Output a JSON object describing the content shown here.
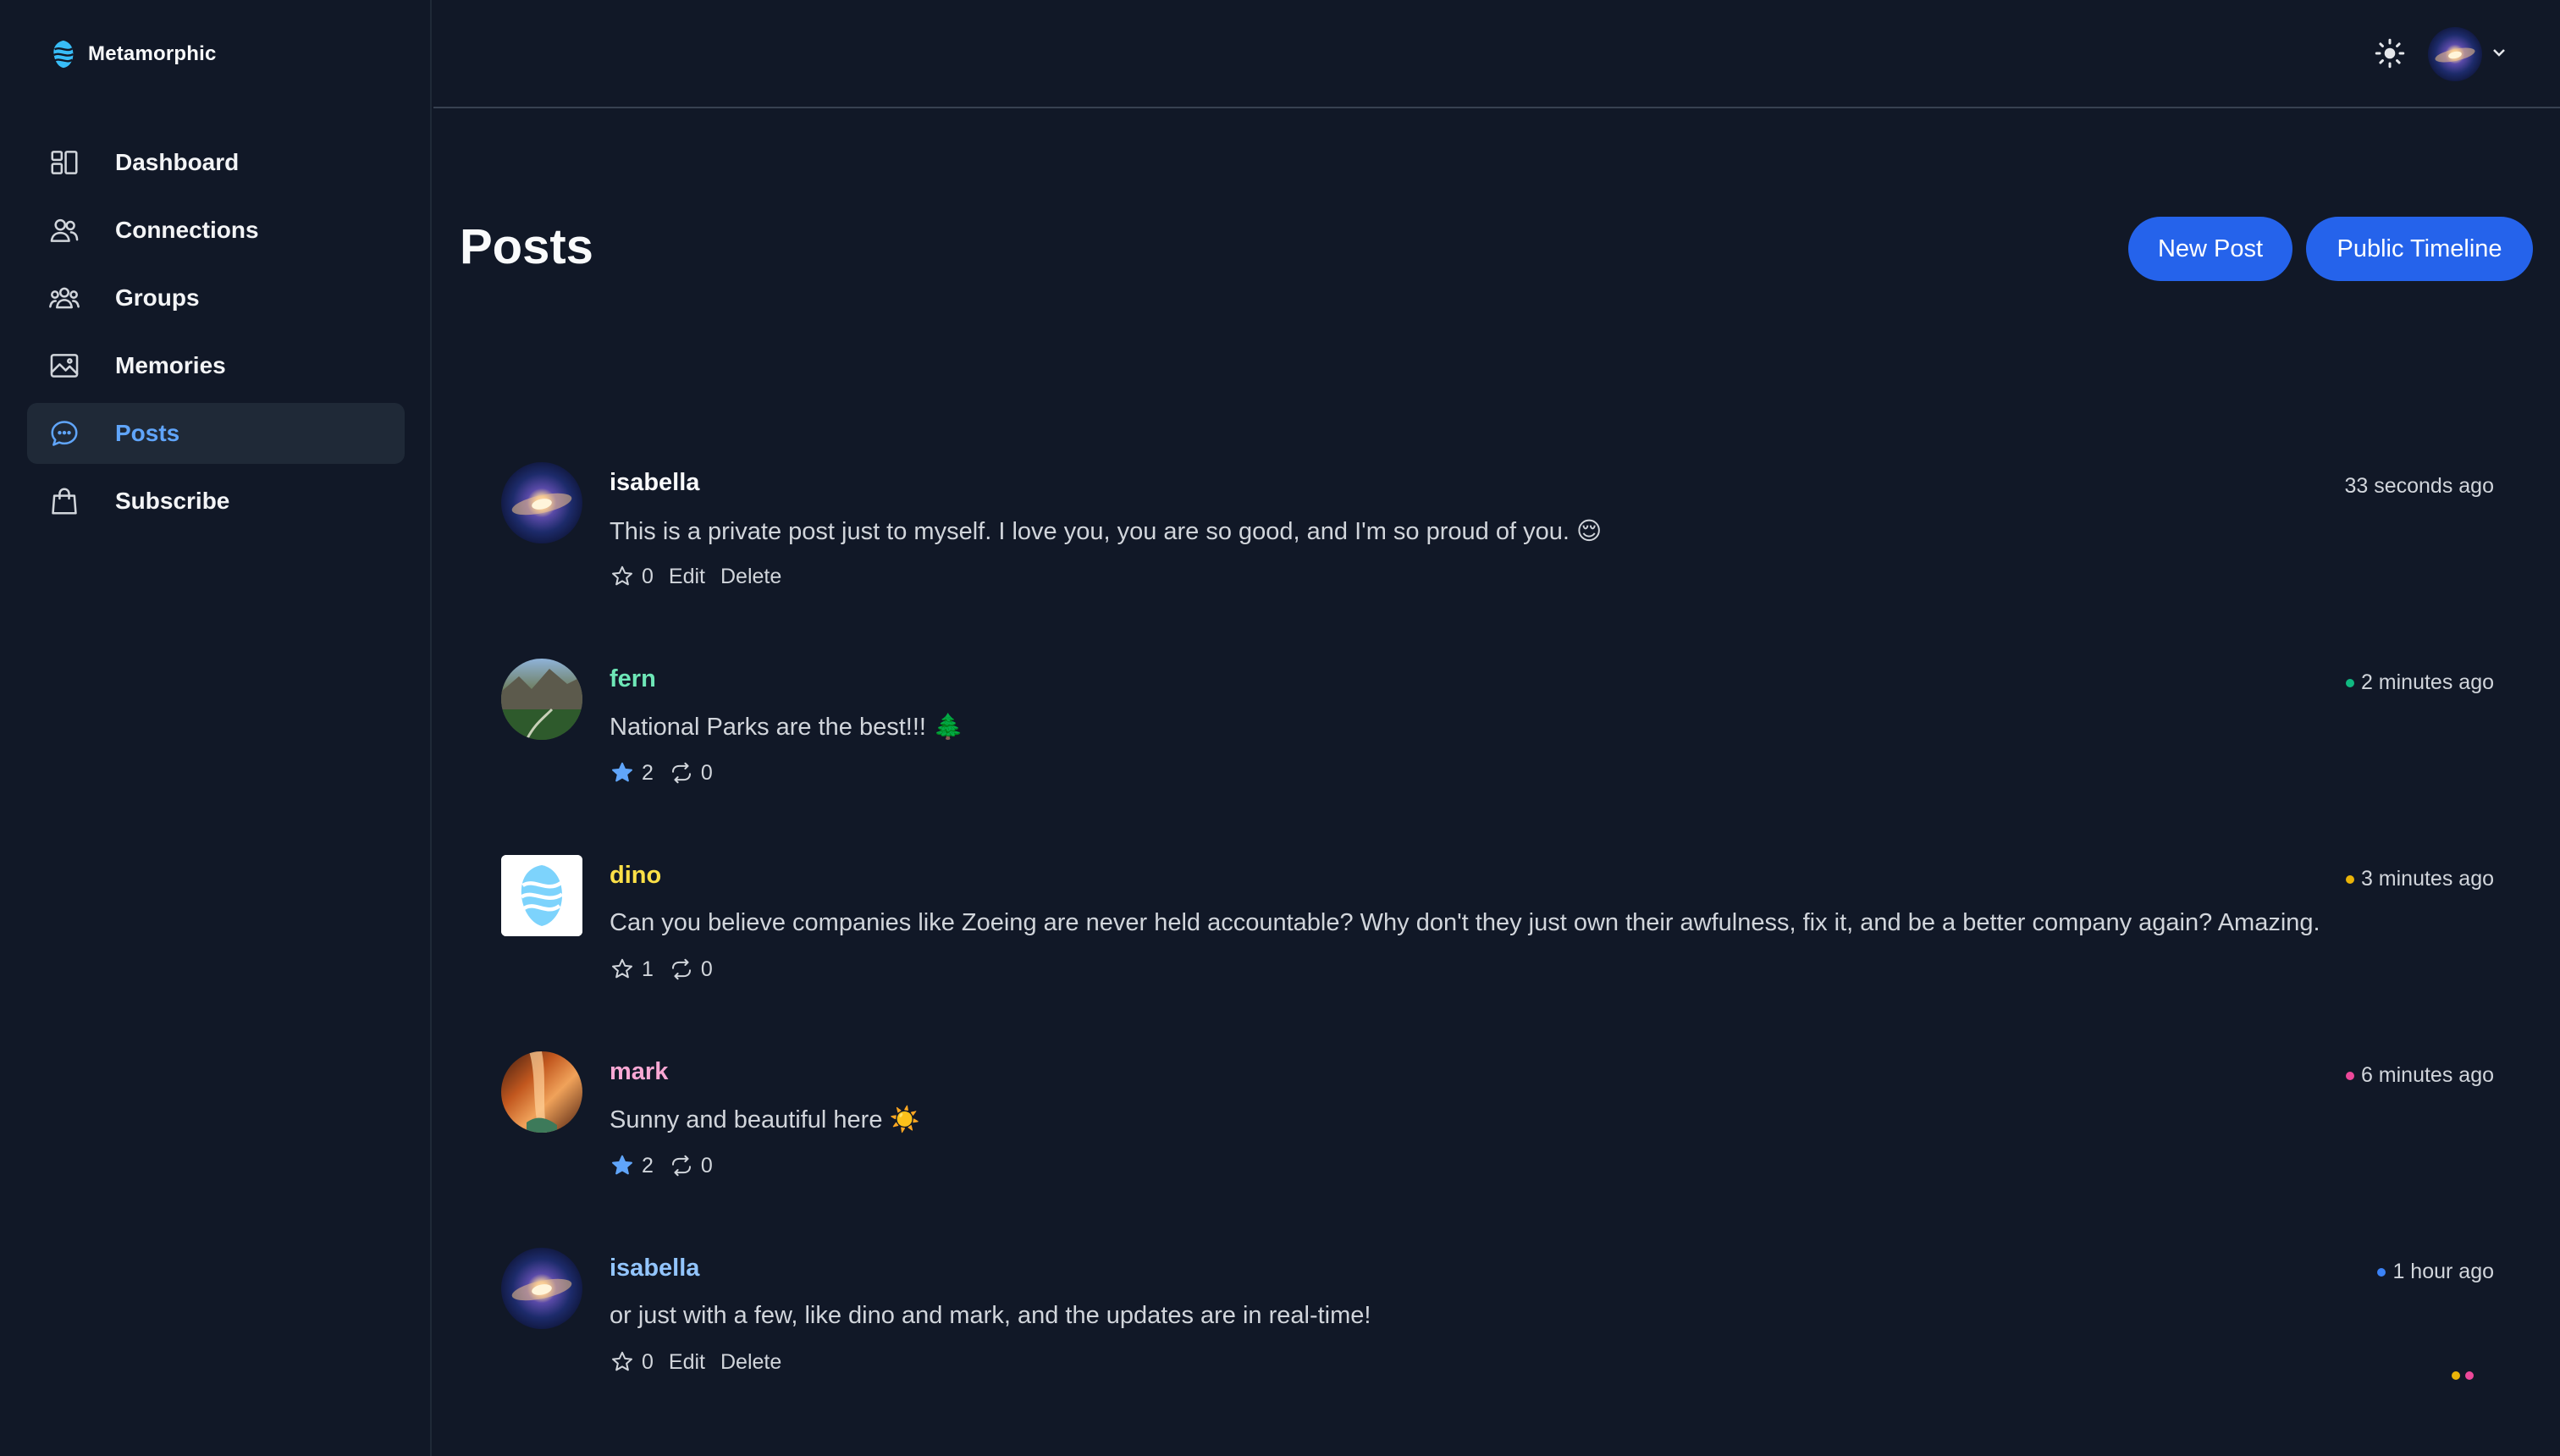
{
  "brand": {
    "name": "Metamorphic"
  },
  "sidebar": {
    "items": [
      {
        "label": "Dashboard",
        "icon": "dashboard-icon",
        "active": false
      },
      {
        "label": "Connections",
        "icon": "users-icon",
        "active": false
      },
      {
        "label": "Groups",
        "icon": "group-icon",
        "active": false
      },
      {
        "label": "Memories",
        "icon": "image-icon",
        "active": false
      },
      {
        "label": "Posts",
        "icon": "chat-bubble-icon",
        "active": true
      },
      {
        "label": "Subscribe",
        "icon": "shopping-bag-icon",
        "active": false
      }
    ]
  },
  "topbar": {
    "theme_icon": "sun-icon",
    "user_avatar": "galaxy-avatar",
    "menu_icon": "chevron-down-icon"
  },
  "page": {
    "title": "Posts"
  },
  "buttons": {
    "new_post": "New Post",
    "public_timeline": "Public Timeline"
  },
  "colors": {
    "accent": "#2563eb",
    "active_nav": "#60a5fa",
    "background": "#111827",
    "fern": "#6ee7b7",
    "dino": "#fde047",
    "mark": "#f9a8d4",
    "isabella_connection": "#93c5fd",
    "dot_green": "#10b981",
    "dot_yellow": "#eab308",
    "dot_pink": "#ec4899",
    "dot_blue": "#3b82f6"
  },
  "posts": [
    {
      "author": "isabella",
      "time": "33 seconds ago",
      "body": "This is a private post just to myself. I love you, you are so good, and I'm so proud of you. 😌",
      "favs": "0",
      "reposts": "",
      "edit": "Edit",
      "delete": "Delete"
    },
    {
      "author": "fern",
      "time": "2 minutes ago",
      "body": "National Parks are the best!!! 🌲",
      "favs": "2",
      "reposts": "0"
    },
    {
      "author": "dino",
      "time": "3 minutes ago",
      "body": "Can you believe companies like Zoeing are never held accountable? Why don't they just own their awfulness, fix it, and be a better company again? Amazing.",
      "favs": "1",
      "reposts": "0"
    },
    {
      "author": "mark",
      "time": "6 minutes ago",
      "body": "Sunny and beautiful here ☀️",
      "favs": "2",
      "reposts": "0"
    },
    {
      "author": "isabella",
      "time": "1 hour ago",
      "body": "or just with a few, like dino and mark, and the updates are in real-time!",
      "favs": "0",
      "edit": "Edit",
      "delete": "Delete"
    }
  ]
}
